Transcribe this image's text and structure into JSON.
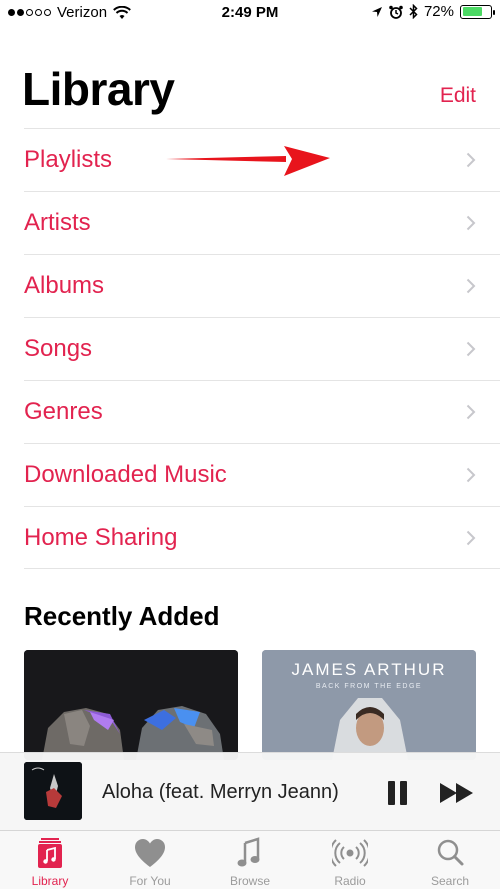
{
  "status_bar": {
    "carrier": "Verizon",
    "time": "2:49 PM",
    "battery_percent": "72%",
    "battery_level": 0.72
  },
  "header": {
    "title": "Library",
    "edit_label": "Edit"
  },
  "menu": {
    "items": [
      {
        "label": "Playlists"
      },
      {
        "label": "Artists"
      },
      {
        "label": "Albums"
      },
      {
        "label": "Songs"
      },
      {
        "label": "Genres"
      },
      {
        "label": "Downloaded Music"
      },
      {
        "label": "Home Sharing"
      }
    ]
  },
  "recently_added": {
    "title": "Recently Added",
    "albums": [
      {
        "artist": "",
        "subtitle": ""
      },
      {
        "artist": "JAMES ARTHUR",
        "subtitle": "BACK FROM THE EDGE"
      }
    ]
  },
  "mini_player": {
    "track_title": "Aloha (feat. Merryn Jeann)"
  },
  "tab_bar": {
    "tabs": [
      {
        "label": "Library",
        "icon": "library-icon",
        "active": true
      },
      {
        "label": "For You",
        "icon": "heart-icon",
        "active": false
      },
      {
        "label": "Browse",
        "icon": "music-note-icon",
        "active": false
      },
      {
        "label": "Radio",
        "icon": "radio-icon",
        "active": false
      },
      {
        "label": "Search",
        "icon": "search-icon",
        "active": false
      }
    ]
  },
  "colors": {
    "accent": "#e2234f",
    "annotation_arrow": "#e8141c",
    "battery": "#4cd964"
  }
}
